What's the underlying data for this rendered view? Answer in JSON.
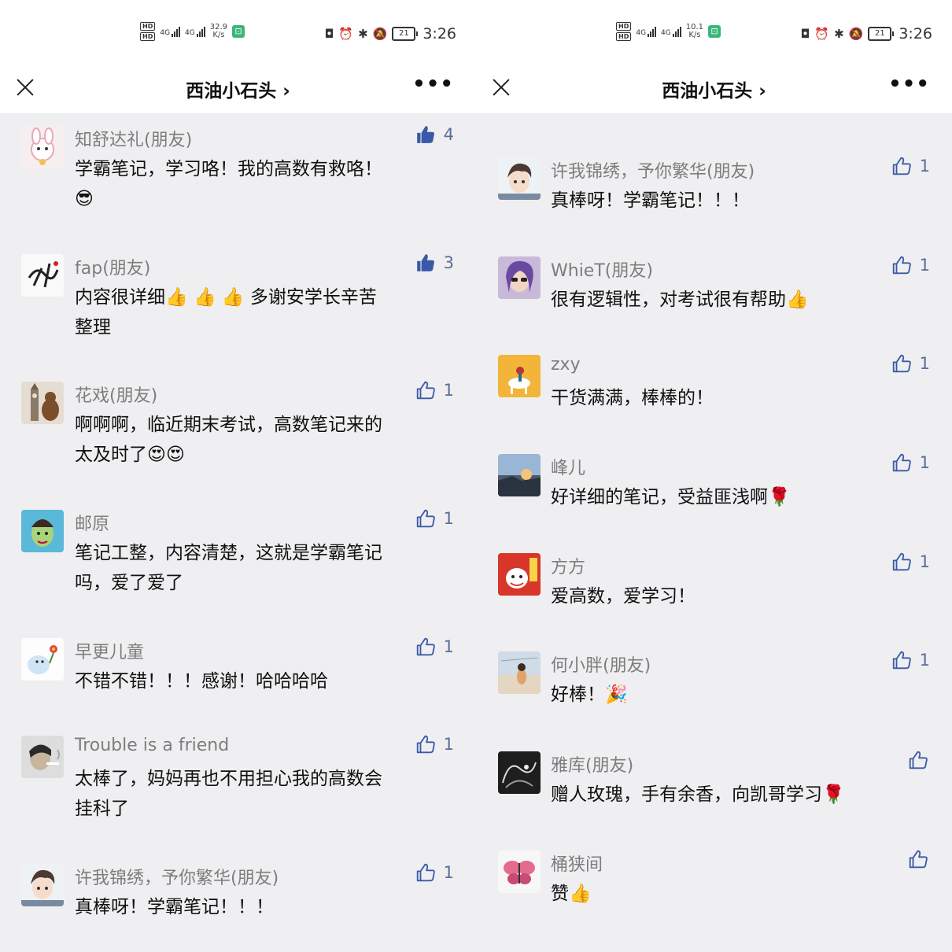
{
  "status_left": {
    "net_type_1": "4G",
    "net_type_2": "4G",
    "hd_1": "HD",
    "hd_2": "HD",
    "left_speed_value": "32.9",
    "right_speed_value": "10.1",
    "speed_unit": "K/s"
  },
  "status_right": {
    "battery": "21",
    "time": "3:26"
  },
  "nav": {
    "title": "西油小石头 ›",
    "more": "•••"
  },
  "colors": {
    "name_gray": "#7d7d7d",
    "like_blue": "#3a5aa8",
    "page_bg": "#efeff1"
  },
  "left_comments": [
    {
      "name": "知舒达礼(朋友)",
      "line1": "学霸笔记，学习咯！我的高数有救咯！",
      "line2": "",
      "emoji": "😎",
      "likes": "4",
      "liked": true,
      "avatar": "bunny-avatar"
    },
    {
      "name": "fap(朋友)",
      "line1": "内容很详细👍 👍 👍 多谢安学长辛苦",
      "line2": "整理",
      "emoji": "",
      "likes": "3",
      "liked": true,
      "avatar": "calligraphy-avatar"
    },
    {
      "name": "花戏(朋友)",
      "line1": "啊啊啊，临近期末考试，高数笔记来的",
      "line2": "太及时了😍😍",
      "emoji": "",
      "likes": "1",
      "liked": false,
      "avatar": "bigben-bear-avatar"
    },
    {
      "name": "邮原",
      "line1": "笔记工整，内容清楚，这就是学霸笔记",
      "line2": "吗，爱了爱了",
      "emoji": "",
      "likes": "1",
      "liked": false,
      "avatar": "painted-face-avatar"
    },
    {
      "name": "早更儿童",
      "line1": "不错不错！！！感谢！哈哈哈哈",
      "line2": "",
      "emoji": "",
      "likes": "1",
      "liked": false,
      "avatar": "cartoon-flower-avatar"
    },
    {
      "name": "Trouble is a friend",
      "line1": "太棒了，妈妈再也不用担心我的高数会",
      "line2": "挂科了",
      "emoji": "",
      "likes": "1",
      "liked": false,
      "avatar": "smoking-man-avatar"
    },
    {
      "name": "许我锦绣，予你繁华(朋友)",
      "line1": "真棒呀！学霸笔记！！！",
      "line2": "",
      "emoji": "",
      "likes": "1",
      "liked": false,
      "avatar": "anime-boy-avatar"
    }
  ],
  "right_comments": [
    {
      "name": "许我锦绣，予你繁华(朋友)",
      "line1": "真棒呀！学霸笔记！！！",
      "likes": "1",
      "avatar": "anime-boy-avatar"
    },
    {
      "name": "WhieT(朋友)",
      "line1": "很有逻辑性，对考试很有帮助👍",
      "likes": "1",
      "avatar": "girl-sunglasses-avatar"
    },
    {
      "name": "zxy",
      "line1": "干货满满，棒棒的！",
      "likes": "1",
      "avatar": "horse-rider-avatar"
    },
    {
      "name": "峰儿",
      "line1": "好详细的笔记，受益匪浅啊🌹",
      "likes": "1",
      "avatar": "sunset-avatar"
    },
    {
      "name": "方方",
      "line1": "爱高数，爱学习！",
      "likes": "1",
      "avatar": "red-cartoon-avatar"
    },
    {
      "name": "何小胖(朋友)",
      "line1": "好棒！🎉",
      "likes": "1",
      "avatar": "beach-girl-avatar"
    },
    {
      "name": "雅库(朋友)",
      "line1": "赠人玫瑰，手有余香，向凯哥学习🌹",
      "likes": "",
      "avatar": "dragon-sketch-avatar"
    },
    {
      "name": "桶狭间",
      "line1": "赞👍",
      "likes": "",
      "avatar": "butterfly-avatar"
    }
  ]
}
